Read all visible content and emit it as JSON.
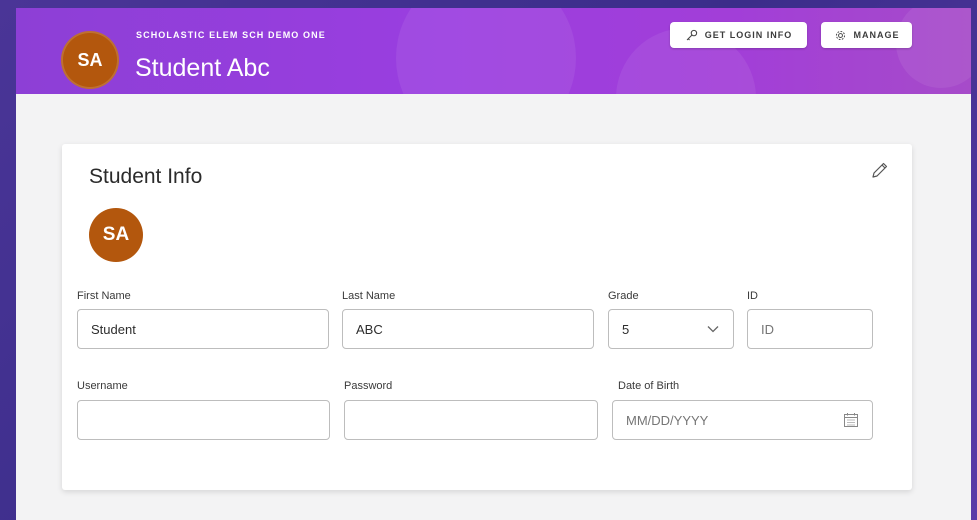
{
  "header": {
    "school_name": "SCHOLASTIC ELEM SCH DEMO ONE",
    "student_name": "Student Abc",
    "avatar_initials": "SA",
    "buttons": {
      "get_login_info": "GET LOGIN INFO",
      "manage": "MANAGE"
    }
  },
  "card": {
    "title": "Student Info",
    "avatar_initials": "SA",
    "fields": {
      "first_name": {
        "label": "First Name",
        "value": "Student"
      },
      "last_name": {
        "label": "Last Name",
        "value": "ABC"
      },
      "grade": {
        "label": "Grade",
        "value": "5"
      },
      "id": {
        "label": "ID",
        "placeholder": "ID"
      },
      "username": {
        "label": "Username",
        "value": ""
      },
      "password": {
        "label": "Password",
        "value": ""
      },
      "date_of_birth": {
        "label": "Date of Birth",
        "placeholder": "MM/DD/YYYY"
      }
    }
  },
  "colors": {
    "header_purple": "#9a3ee0",
    "avatar_orange": "#b3570d"
  },
  "icons": [
    "key-icon",
    "gear-icon",
    "pencil-icon",
    "chevron-down-icon",
    "calendar-icon"
  ]
}
